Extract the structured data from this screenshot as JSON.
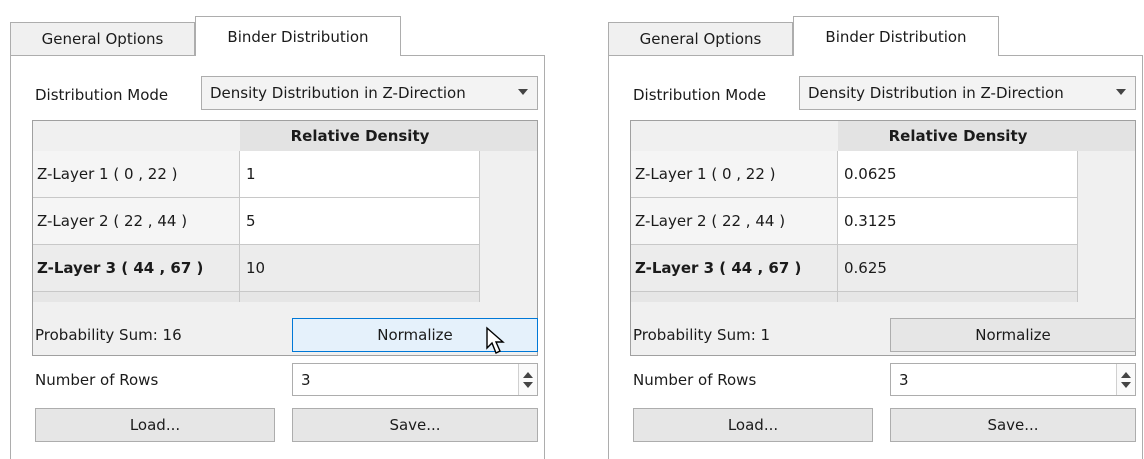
{
  "tabs": [
    "General Options",
    "Binder Distribution"
  ],
  "distribution_mode_label": "Distribution Mode",
  "distribution_mode_value": "Density Distribution in Z-Direction",
  "table_header": "Relative Density",
  "number_of_rows_label": "Number of Rows",
  "normalize_label": "Normalize",
  "load_label": "Load...",
  "save_label": "Save...",
  "panels": [
    {
      "probability_sum": "Probability Sum: 16",
      "number_of_rows": "3",
      "rows": [
        {
          "label": "Z-Layer 1 ( 0 , 22 )",
          "value": "1"
        },
        {
          "label": "Z-Layer 2 ( 22 , 44 )",
          "value": "5"
        },
        {
          "label": "Z-Layer 3 ( 44 , 67 )",
          "value": "10"
        }
      ]
    },
    {
      "probability_sum": "Probability Sum: 1",
      "number_of_rows": "3",
      "rows": [
        {
          "label": "Z-Layer 1 ( 0 , 22 )",
          "value": "0.0625"
        },
        {
          "label": "Z-Layer 2 ( 22 , 44 )",
          "value": "0.3125"
        },
        {
          "label": "Z-Layer 3 ( 44 , 67 )",
          "value": "0.625"
        }
      ]
    }
  ],
  "icons": {
    "cursor": "mouse-pointer-icon",
    "combo_arrow": "chevron-down-icon",
    "spin": "spinbox-arrows-icon"
  },
  "colors": {
    "hover_border": "#0078d7",
    "hover_fill": "#e5f1fb"
  }
}
